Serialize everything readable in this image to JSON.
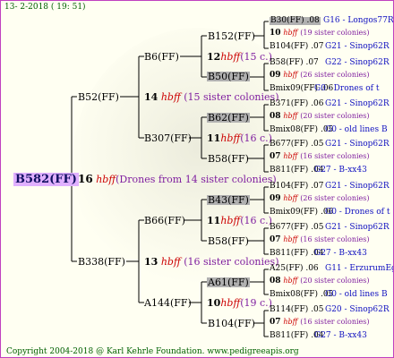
{
  "header": "13-  2-2018 ( 19: 51)",
  "footer": "Copyright 2004-2018 @ Karl Kehrle Foundation.   www.pedigreeapis.org",
  "root": {
    "name": "B582(FF)",
    "gen_num": "16",
    "hbff": "hbff",
    "desc": "(Drones from 14 sister colonies)"
  },
  "level1": [
    {
      "name": "B52(FF)",
      "gen_num": "14",
      "hbff": "hbff",
      "desc": "(15 sister colonies)"
    },
    {
      "name": "B338(FF)",
      "gen_num": "13",
      "hbff": "hbff",
      "desc": "(16 sister colonies)"
    }
  ],
  "level2": [
    {
      "name": "B6(FF)",
      "gen_num": "12",
      "hbff": "hbff",
      "desc": "(15 c.)"
    },
    {
      "name": "B307(FF)",
      "gen_num": "11",
      "hbff": "hbff",
      "desc": "(16 c.)"
    },
    {
      "name": "B66(FF)",
      "gen_num": "11",
      "hbff": "hbff",
      "desc": "(16 c.)"
    },
    {
      "name": "A144(FF)",
      "gen_num": "10",
      "hbff": "hbff",
      "desc": "(19 c.)"
    }
  ],
  "level3": [
    {
      "name": "B152(FF)"
    },
    {
      "name": "B50(FF)"
    },
    {
      "name": "B62(FF)"
    },
    {
      "name": "B58(FF)"
    },
    {
      "name": "B43(FF)"
    },
    {
      "name": "B58(FF)"
    },
    {
      "name": "A61(FF)"
    },
    {
      "name": "B104(FF)"
    }
  ],
  "level4": [
    {
      "top_name": "B30(FF)",
      "top_year": ".08",
      "top_info": "G16 - Longos77R",
      "num": "10",
      "hbff": "hbff",
      "cols": "(19 sister colonies)",
      "bot_name": "B104(FF)",
      "bot_year": ".07",
      "bot_info": "G21 - Sinop62R"
    },
    {
      "top_name": "B58(FF)",
      "top_year": ".07",
      "top_info": "G22 - Sinop62R",
      "num": "09",
      "hbff": "hbff",
      "cols": "(26 sister colonies)",
      "bot_name": "Bmix09(FF)",
      "bot_year": ".06",
      "bot_info": "G0 - Drones of t"
    },
    {
      "top_name": "B371(FF)",
      "top_year": ".06",
      "top_info": "G21 - Sinop62R",
      "num": "08",
      "hbff": "hbff",
      "cols": "(20 sister colonies)",
      "bot_name": "Bmix08(FF)",
      "bot_year": ".05",
      "bot_info": "G0 - old lines B"
    },
    {
      "top_name": "B677(FF)",
      "top_year": ".05",
      "top_info": "G21 - Sinop62R",
      "num": "07",
      "hbff": "hbff",
      "cols": "(16 sister colonies)",
      "bot_name": "B811(FF)",
      "bot_year": ".04",
      "bot_info": "G27 - B-xx43"
    },
    {
      "top_name": "B104(FF)",
      "top_year": ".07",
      "top_info": "G21 - Sinop62R",
      "num": "09",
      "hbff": "hbff",
      "cols": "(26 sister colonies)",
      "bot_name": "Bmix09(FF)",
      "bot_year": ".06",
      "bot_info": "G0 - Drones of t"
    },
    {
      "top_name": "B677(FF)",
      "top_year": ".05",
      "top_info": "G21 - Sinop62R",
      "num": "07",
      "hbff": "hbff",
      "cols": "(16 sister colonies)",
      "bot_name": "B811(FF)",
      "bot_year": ".04",
      "bot_info": "G27 - B-xx43"
    },
    {
      "top_name": "A25(FF)",
      "top_year": ".06",
      "top_info": "G11 - ErzurumEgg8",
      "num": "08",
      "hbff": "hbff",
      "cols": "(20 sister colonies)",
      "bot_name": "Bmix08(FF)",
      "bot_year": ".05",
      "bot_info": "G0 - old lines B"
    },
    {
      "top_name": "B114(FF)",
      "top_year": ".05",
      "top_info": "G20 - Sinop62R",
      "num": "07",
      "hbff": "hbff",
      "cols": "(16 sister colonies)",
      "bot_name": "B811(FF)",
      "bot_year": ".04",
      "bot_info": "G27 - B-xx43"
    }
  ]
}
